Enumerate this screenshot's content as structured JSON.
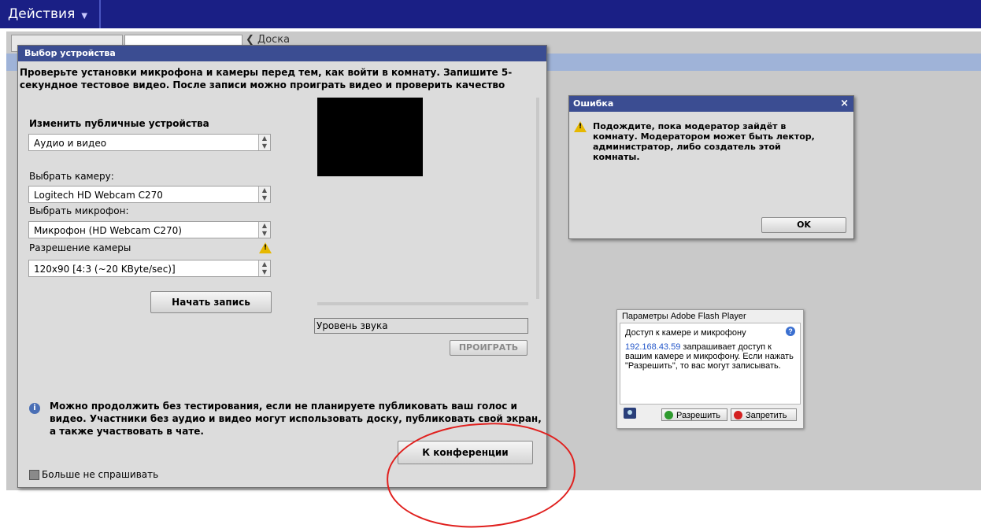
{
  "topbar": {
    "menu_label": "Действия"
  },
  "background": {
    "tab_board": "Доска"
  },
  "device_dialog": {
    "title": "Выбор устройства",
    "intro": "Проверьте установки микрофона и камеры перед тем, как войти в комнату. Запишите 5-секундное тестовое видео. После записи можно проиграть видео и проверить качество",
    "public_devices_label": "Изменить публичные устройства",
    "public_devices_value": "Аудио и видео",
    "camera_label": "Выбрать камеру:",
    "camera_value": "Logitech HD Webcam C270",
    "mic_label": "Выбрать микрофон:",
    "mic_value": "Микрофон (HD Webcam C270)",
    "resolution_label": "Разрешение камеры",
    "resolution_value": "120x90 [4:3 (~20 KByte/sec)]",
    "record_button": "Начать запись",
    "sound_level": "Уровень звука",
    "play_button": "ПРОИГРАТЬ",
    "note": "Можно продолжить без тестирования, если не планируете публиковать ваш голос и видео. Участники без аудио и видео могут использовать доску, публиковать свой экран, а также участвовать в чате.",
    "conference_button": "К конференции",
    "dont_ask_label": "Больше не спрашивать"
  },
  "error_dialog": {
    "title": "Ошибка",
    "close": "×",
    "message": "Подождите, пока модератор зайдёт в комнату. Модератором может быть лектор, администратор, либо создатель этой комнаты.",
    "ok_button": "OK"
  },
  "flash_dialog": {
    "title": "Параметры Adobe Flash Player",
    "heading": "Доступ к камере и микрофону",
    "ip": "192.168.43.59",
    "body": " запрашивает доступ к вашим камере и микрофону. Если нажать \"Разрешить\", то вас могут записывать.",
    "allow_button": "Разрешить",
    "deny_button": "Запретить"
  },
  "colors": {
    "topbar": "#1a1f85",
    "title_bar": "#3b4d92",
    "annotation": "#e0201e"
  }
}
